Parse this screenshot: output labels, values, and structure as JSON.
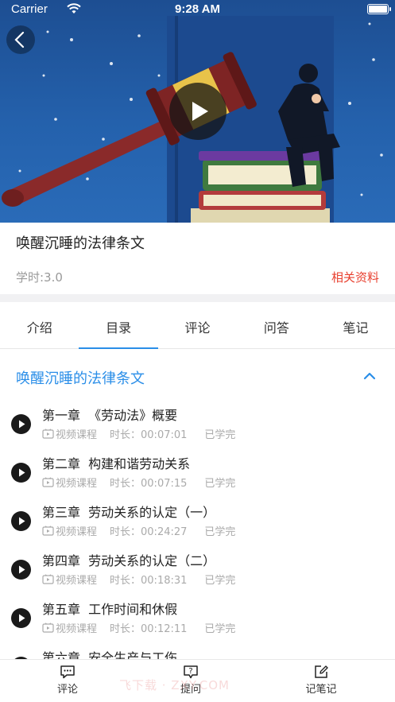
{
  "status_bar": {
    "carrier": "Carrier",
    "time": "9:28 AM"
  },
  "course": {
    "title": "唤醒沉睡的法律条文",
    "hours": "学时:3.0",
    "materials_link": "相关资料"
  },
  "tabs": [
    {
      "label": "介绍"
    },
    {
      "label": "目录"
    },
    {
      "label": "评论"
    },
    {
      "label": "问答"
    },
    {
      "label": "笔记"
    }
  ],
  "active_tab": "目录",
  "chapter": {
    "title": "唤醒沉睡的法律条文"
  },
  "lessons": [
    {
      "name": "第一章  《劳动法》概要",
      "type": "视频课程",
      "duration": "时长：00:07:01",
      "status": "已学完"
    },
    {
      "name": "第二章  构建和谐劳动关系",
      "type": "视频课程",
      "duration": "时长：00:07:15",
      "status": "已学完"
    },
    {
      "name": "第三章  劳动关系的认定（一）",
      "type": "视频课程",
      "duration": "时长：00:24:27",
      "status": "已学完"
    },
    {
      "name": "第四章  劳动关系的认定（二）",
      "type": "视频课程",
      "duration": "时长：00:18:31",
      "status": "已学完"
    },
    {
      "name": "第五章  工作时间和休假",
      "type": "视频课程",
      "duration": "时长：00:12:11",
      "status": "已学完"
    },
    {
      "name": "第六章  安全生产与工伤",
      "type": "",
      "duration": "",
      "status": ""
    }
  ],
  "bottom_bar": {
    "comment": "评论",
    "ask": "提问",
    "note": "记笔记"
  },
  "watermark": "飞下载 · ZXY.COM",
  "colors": {
    "accent": "#2a8ee8",
    "link_red": "#e8402f",
    "video_bg": "#2461ac"
  },
  "icons": [
    "back-icon",
    "play-icon",
    "wifi-icon",
    "battery-icon",
    "chevron-up-icon",
    "video-icon",
    "comment-icon",
    "question-icon",
    "edit-note-icon"
  ]
}
